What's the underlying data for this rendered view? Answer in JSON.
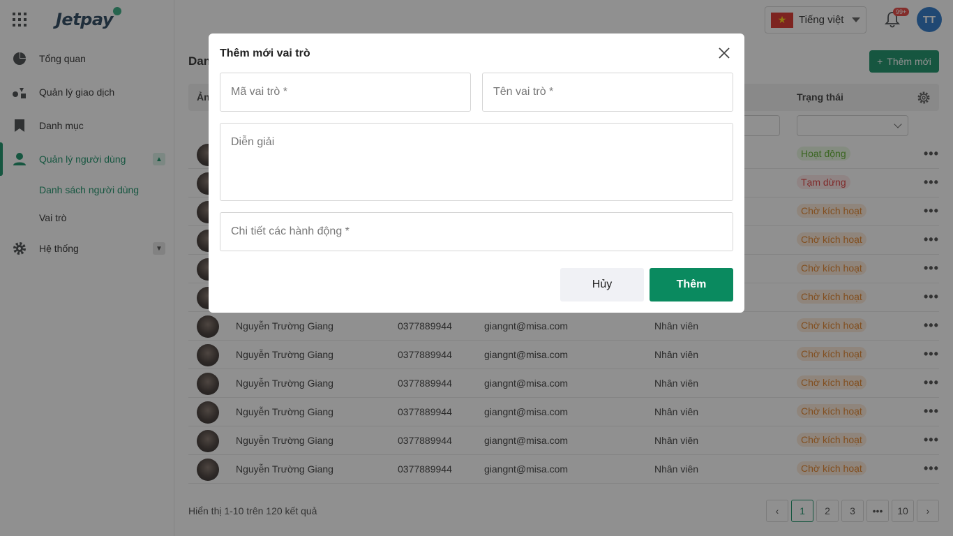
{
  "sidebar": {
    "logo": "Jetpay",
    "items": [
      {
        "label": "Tổng quan"
      },
      {
        "label": "Quản lý giao dịch"
      },
      {
        "label": "Danh mục"
      },
      {
        "label": "Quản lý người dùng"
      },
      {
        "label": "Hệ thống"
      }
    ],
    "sub_items": [
      {
        "label": "Danh sách người dùng"
      },
      {
        "label": "Vai trò"
      }
    ]
  },
  "header": {
    "language": "Tiếng việt",
    "notification_badge": "99+",
    "avatar_initials": "TT"
  },
  "main": {
    "title_visible": "Dan",
    "add_button": "Thêm mới",
    "columns": {
      "avatar": "Ản",
      "status": "Trạng thái"
    },
    "rows": [
      {
        "name": "",
        "phone": "",
        "email": "",
        "role": "",
        "status": "Hoạt động",
        "status_type": "active"
      },
      {
        "name": "",
        "phone": "",
        "email": "",
        "role": "",
        "status": "Tạm dừng",
        "status_type": "paused"
      },
      {
        "name": "",
        "phone": "",
        "email": "",
        "role": "",
        "status": "Chờ kích hoạt",
        "status_type": "pending"
      },
      {
        "name": "",
        "phone": "",
        "email": "",
        "role": "",
        "status": "Chờ kích hoạt",
        "status_type": "pending"
      },
      {
        "name": "",
        "phone": "",
        "email": "",
        "role": "",
        "status": "Chờ kích hoạt",
        "status_type": "pending"
      },
      {
        "name": "",
        "phone": "",
        "email": "",
        "role": "",
        "status": "Chờ kích hoạt",
        "status_type": "pending"
      },
      {
        "name": "Nguyễn Trường Giang",
        "phone": "0377889944",
        "email": "giangnt@misa.com",
        "role": "Nhân viên",
        "status": "Chờ kích hoạt",
        "status_type": "pending"
      },
      {
        "name": "Nguyễn Trường Giang",
        "phone": "0377889944",
        "email": "giangnt@misa.com",
        "role": "Nhân viên",
        "status": "Chờ kích hoạt",
        "status_type": "pending"
      },
      {
        "name": "Nguyễn Trường Giang",
        "phone": "0377889944",
        "email": "giangnt@misa.com",
        "role": "Nhân viên",
        "status": "Chờ kích hoạt",
        "status_type": "pending"
      },
      {
        "name": "Nguyễn Trường Giang",
        "phone": "0377889944",
        "email": "giangnt@misa.com",
        "role": "Nhân viên",
        "status": "Chờ kích hoạt",
        "status_type": "pending"
      },
      {
        "name": "Nguyễn Trường Giang",
        "phone": "0377889944",
        "email": "giangnt@misa.com",
        "role": "Nhân viên",
        "status": "Chờ kích hoạt",
        "status_type": "pending"
      },
      {
        "name": "Nguyễn Trường Giang",
        "phone": "0377889944",
        "email": "giangnt@misa.com",
        "role": "Nhân viên",
        "status": "Chờ kích hoạt",
        "status_type": "pending"
      }
    ],
    "more_icon": "•••",
    "footer_text": "Hiển thị 1-10 trên 120 kết quả",
    "pagination": [
      "‹",
      "1",
      "2",
      "3",
      "•••",
      "10",
      "›"
    ],
    "current_page": "1"
  },
  "modal": {
    "title": "Thêm mới vai trò",
    "code_placeholder": "Mã vai trò *",
    "name_placeholder": "Tên vai trò *",
    "description_placeholder": "Diễn giải",
    "actions_placeholder": "Chi tiết các hành động *",
    "cancel_label": "Hủy",
    "submit_label": "Thêm"
  },
  "colors": {
    "brand": "#0a8a5f",
    "overlay": "rgba(33,33,33,0.5)"
  }
}
